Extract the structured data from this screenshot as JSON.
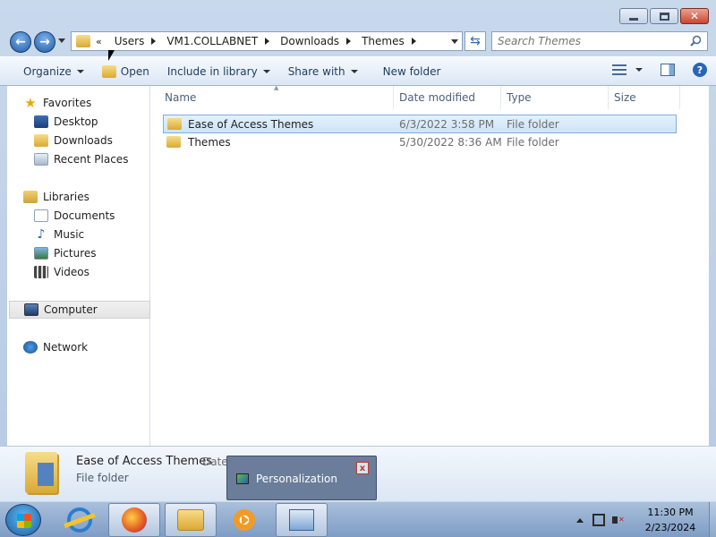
{
  "window": {
    "title": ""
  },
  "address": {
    "overflow": "«",
    "crumbs": [
      "Users",
      "VM1.COLLABNET",
      "Downloads",
      "Themes"
    ]
  },
  "search": {
    "placeholder": "Search Themes"
  },
  "toolbar": {
    "organize": "Organize",
    "open": "Open",
    "include_in_library": "Include in library",
    "share_with": "Share with",
    "new_folder": "New folder"
  },
  "nav": {
    "favorites": "Favorites",
    "desktop": "Desktop",
    "downloads": "Downloads",
    "recent_places": "Recent Places",
    "libraries": "Libraries",
    "documents": "Documents",
    "music": "Music",
    "pictures": "Pictures",
    "videos": "Videos",
    "computer": "Computer",
    "network": "Network"
  },
  "columns": {
    "name": "Name",
    "date_modified": "Date modified",
    "type": "Type",
    "size": "Size"
  },
  "files": [
    {
      "name": "Ease of Access Themes",
      "date": "6/3/2022 3:58 PM",
      "type": "File folder",
      "selected": true
    },
    {
      "name": "Themes",
      "date": "5/30/2022 8:36 AM",
      "type": "File folder",
      "selected": false
    }
  ],
  "details": {
    "name": "Ease of Access Themes",
    "type": "File folder",
    "date_label": "Date"
  },
  "taskbar_popup": {
    "title": "Personalization",
    "close": "x"
  },
  "clock": {
    "time": "11:30 PM",
    "date": "2/23/2024"
  },
  "colors": {
    "selection": "#cde4f9",
    "accent": "#1f5ca8"
  }
}
